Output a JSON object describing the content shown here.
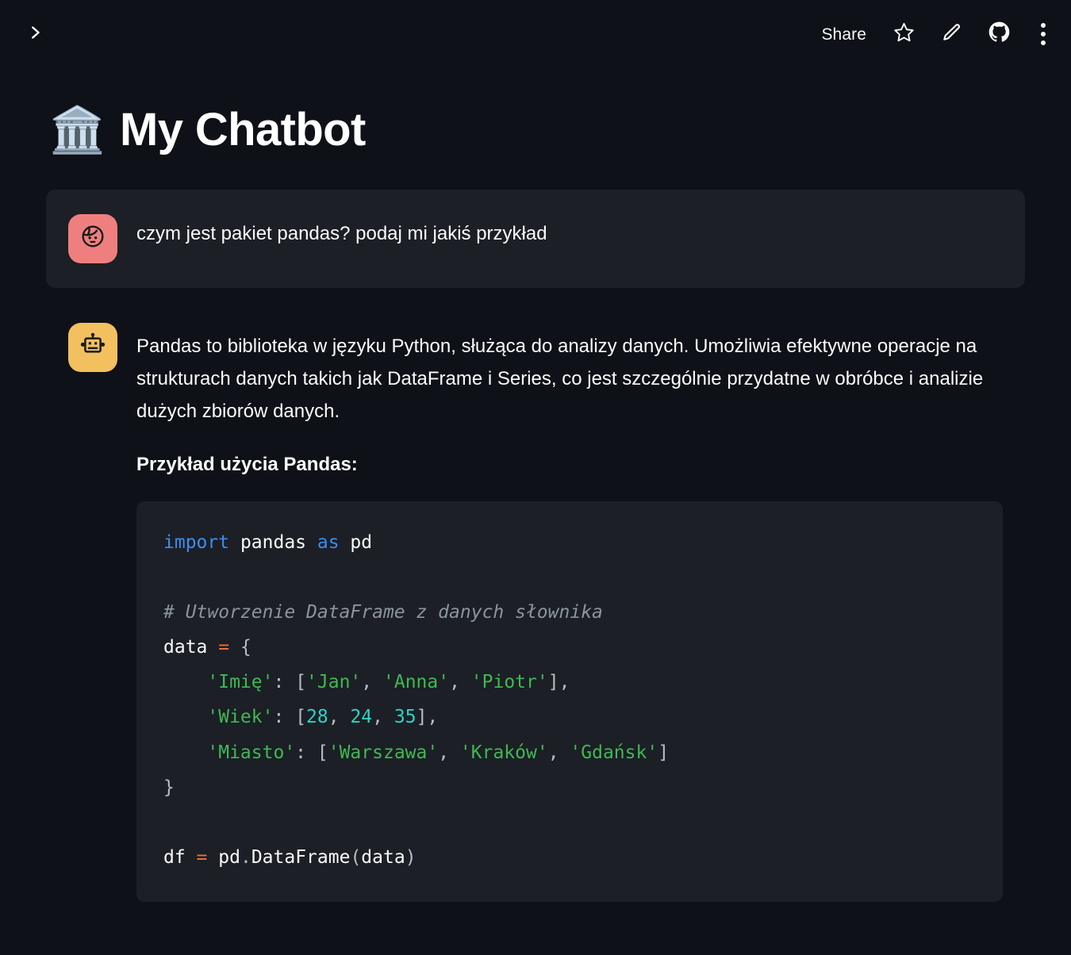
{
  "topbar": {
    "sidebar_toggle_icon": "chevron-right-icon",
    "share_label": "Share",
    "star_icon": "star-icon",
    "edit_icon": "pencil-icon",
    "github_icon": "github-icon",
    "menu_icon": "kebab-menu-icon"
  },
  "page": {
    "title_emoji": "🏛️",
    "title": "My Chatbot",
    "background_color": "#0e1117",
    "surface_color": "#1c1f26"
  },
  "conversation": [
    {
      "role": "user",
      "avatar_icon": "person-face-icon",
      "avatar_color": "#ef7f7f",
      "text": "czym jest pakiet pandas? podaj mi jakiś przykład"
    },
    {
      "role": "assistant",
      "avatar_icon": "robot-face-icon",
      "avatar_color": "#f3c05f",
      "paragraph": "Pandas to biblioteka w języku Python, służąca do analizy danych. Umożliwia efektywne operacje na strukturach danych takich jak DataFrame i Series, co jest szczególnie przydatne w obróbce i analizie dużych zbiorów danych.",
      "subheading": "Przykład użycia Pandas:",
      "code_language": "python",
      "code_plain": "import pandas as pd\n\n# Utworzenie DataFrame z danych słownika\ndata = {\n    'Imię': ['Jan', 'Anna', 'Piotr'],\n    'Wiek': [28, 24, 35],\n    'Miasto': ['Warszawa', 'Kraków', 'Gdańsk']\n}\n\ndf = pd.DataFrame(data)",
      "code_tokens": [
        [
          {
            "t": "import",
            "c": "kw"
          },
          {
            "t": " pandas ",
            "c": "plain"
          },
          {
            "t": "as",
            "c": "kw"
          },
          {
            "t": " pd",
            "c": "plain"
          }
        ],
        [],
        [
          {
            "t": "# Utworzenie DataFrame z danych słownika",
            "c": "comment"
          }
        ],
        [
          {
            "t": "data ",
            "c": "plain"
          },
          {
            "t": "=",
            "c": "op"
          },
          {
            "t": " ",
            "c": "plain"
          },
          {
            "t": "{",
            "c": "punct"
          }
        ],
        [
          {
            "t": "    ",
            "c": "plain"
          },
          {
            "t": "'Imię'",
            "c": "str"
          },
          {
            "t": ": ",
            "c": "punct"
          },
          {
            "t": "[",
            "c": "punct"
          },
          {
            "t": "'Jan'",
            "c": "str"
          },
          {
            "t": ", ",
            "c": "punct"
          },
          {
            "t": "'Anna'",
            "c": "str"
          },
          {
            "t": ", ",
            "c": "punct"
          },
          {
            "t": "'Piotr'",
            "c": "str"
          },
          {
            "t": "],",
            "c": "punct"
          }
        ],
        [
          {
            "t": "    ",
            "c": "plain"
          },
          {
            "t": "'Wiek'",
            "c": "str"
          },
          {
            "t": ": ",
            "c": "punct"
          },
          {
            "t": "[",
            "c": "punct"
          },
          {
            "t": "28",
            "c": "num"
          },
          {
            "t": ", ",
            "c": "punct"
          },
          {
            "t": "24",
            "c": "num"
          },
          {
            "t": ", ",
            "c": "punct"
          },
          {
            "t": "35",
            "c": "num"
          },
          {
            "t": "],",
            "c": "punct"
          }
        ],
        [
          {
            "t": "    ",
            "c": "plain"
          },
          {
            "t": "'Miasto'",
            "c": "str"
          },
          {
            "t": ": ",
            "c": "punct"
          },
          {
            "t": "[",
            "c": "punct"
          },
          {
            "t": "'Warszawa'",
            "c": "str"
          },
          {
            "t": ", ",
            "c": "punct"
          },
          {
            "t": "'Kraków'",
            "c": "str"
          },
          {
            "t": ", ",
            "c": "punct"
          },
          {
            "t": "'Gdańsk'",
            "c": "str"
          },
          {
            "t": "]",
            "c": "punct"
          }
        ],
        [
          {
            "t": "}",
            "c": "punct"
          }
        ],
        [],
        [
          {
            "t": "df ",
            "c": "plain"
          },
          {
            "t": "=",
            "c": "op"
          },
          {
            "t": " pd",
            "c": "plain"
          },
          {
            "t": ".",
            "c": "punct"
          },
          {
            "t": "DataFrame",
            "c": "plain"
          },
          {
            "t": "(",
            "c": "punct"
          },
          {
            "t": "data",
            "c": "plain"
          },
          {
            "t": ")",
            "c": "punct"
          }
        ]
      ]
    }
  ]
}
